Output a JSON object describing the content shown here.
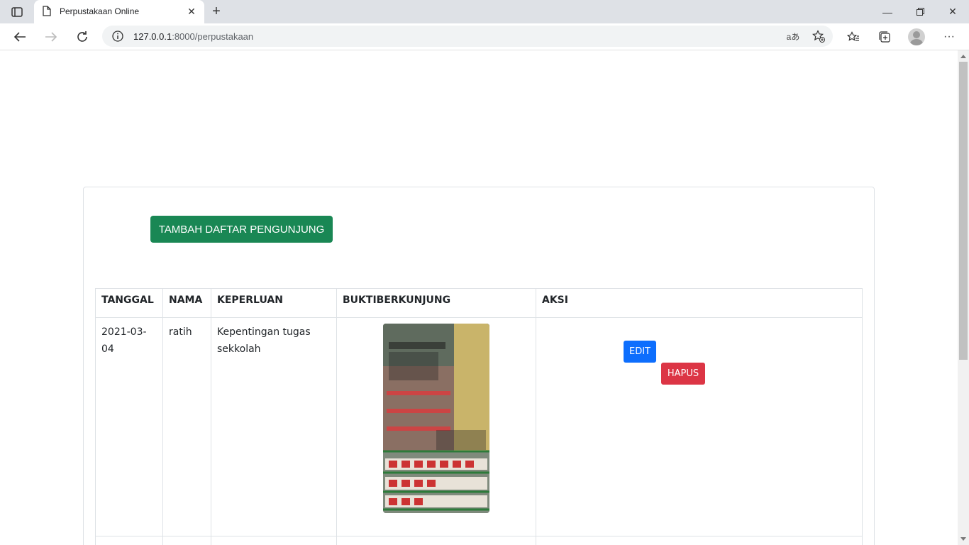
{
  "browser": {
    "tab_title": "Perpustakaan Online",
    "url_host": "127.0.0.1",
    "url_rest": ":8000/perpustakaan"
  },
  "page": {
    "add_button": "TAMBAH DAFTAR PENGUNJUNG",
    "table": {
      "headers": [
        "TANGGAL",
        "NAMA",
        "KEPERLUAN",
        "BUKTIBERKUNJUNG",
        "AKSI"
      ],
      "rows": [
        {
          "tanggal": "2021-03-04",
          "nama": "ratih",
          "keperluan": "Kepentingan tugas sekkolah",
          "edit_label": "EDIT",
          "delete_label": "HAPUS"
        }
      ]
    }
  },
  "colors": {
    "success": "#198754",
    "primary": "#0d6efd",
    "danger": "#dc3545"
  }
}
